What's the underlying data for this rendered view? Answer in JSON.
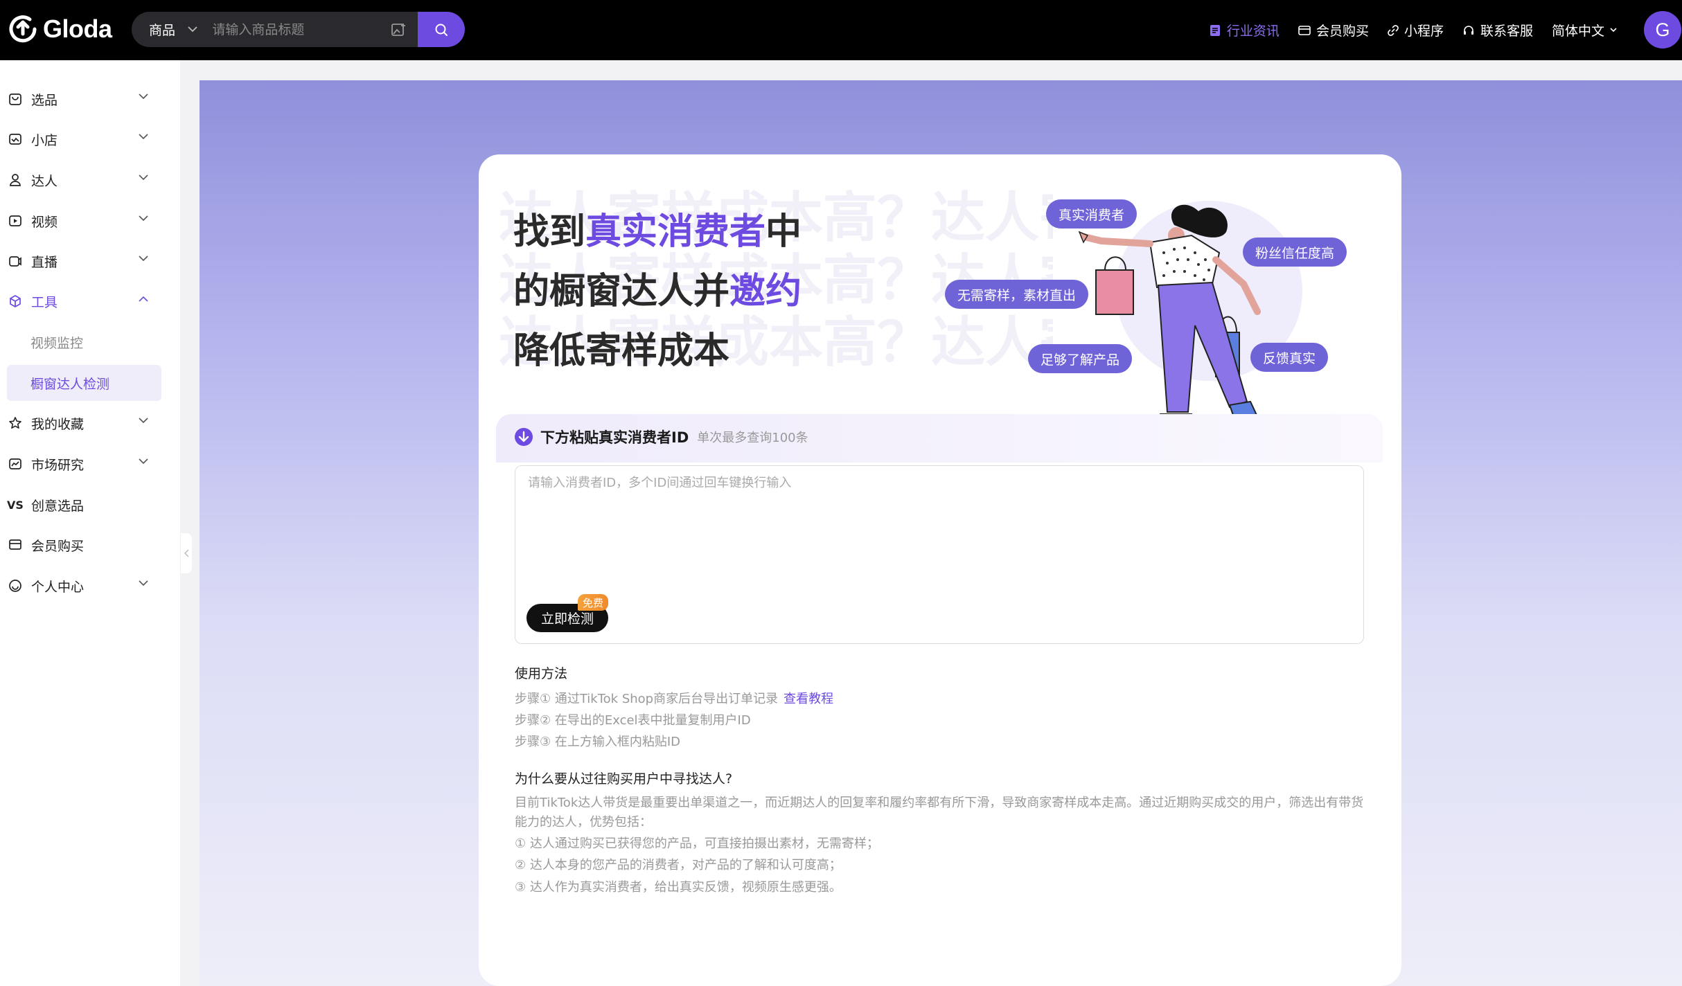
{
  "brand": {
    "name": "Gloda"
  },
  "search": {
    "category": "商品",
    "placeholder": "请输入商品标题"
  },
  "topnav": {
    "industry_news": "行业资讯",
    "membership": "会员购买",
    "mini_program": "小程序",
    "support": "联系客服",
    "language": "简体中文",
    "avatar_letter": "G"
  },
  "sidebar": {
    "items": [
      {
        "label": "选品",
        "icon": "bag-icon"
      },
      {
        "label": "小店",
        "icon": "store-icon"
      },
      {
        "label": "达人",
        "icon": "user-icon"
      },
      {
        "label": "视频",
        "icon": "video-icon"
      },
      {
        "label": "直播",
        "icon": "live-icon"
      },
      {
        "label": "工具",
        "icon": "cube-icon"
      },
      {
        "label": "我的收藏",
        "icon": "star-icon"
      },
      {
        "label": "市场研究",
        "icon": "chart-icon"
      },
      {
        "label": "创意选品",
        "icon": "vs-icon"
      },
      {
        "label": "会员购买",
        "icon": "card-icon"
      },
      {
        "label": "个人中心",
        "icon": "smile-icon"
      }
    ],
    "tools_sub": [
      "视频监控",
      "橱窗达人检测"
    ]
  },
  "hero": {
    "bg_text": "达人寄样成本高？达人寄样成本高？达人",
    "line1_a": "找到",
    "line1_hl": "真实消费者",
    "line1_b": "中",
    "line2_a": "的橱窗达人并",
    "line2_hl": "邀约",
    "line3": "降低寄样成本",
    "bubbles": [
      "真实消费者",
      "粉丝信任度高",
      "无需寄样，素材直出",
      "足够了解产品",
      "反馈真实"
    ]
  },
  "section": {
    "title": "下方粘贴真实消费者ID",
    "subtitle": "单次最多查询100条",
    "textarea_placeholder": "请输入消费者ID，多个ID间通过回车键换行输入",
    "detect_button": "立即检测",
    "free_badge": "免费"
  },
  "howto": {
    "title": "使用方法",
    "step1": "步骤① 通过TikTok Shop商家后台导出订单记录",
    "step1_link": "查看教程",
    "step2": "步骤② 在导出的Excel表中批量复制用户ID",
    "step3": "步骤③ 在上方输入框内粘贴ID"
  },
  "why": {
    "title": "为什么要从过往购买用户中寻找达人?",
    "intro": "目前TikTok达人带货是最重要出单渠道之一，而近期达人的回复率和履约率都有所下滑，导致商家寄样成本走高。通过近期购买成交的用户，筛选出有带货能力的达人，优势包括：",
    "p1": "① 达人通过购买已获得您的产品，可直接拍摄出素材，无需寄样；",
    "p2": "② 达人本身的您产品的消费者，对产品的了解和认可度高；",
    "p3": "③ 达人作为真实消费者，给出真实反馈，视频原生感更强。"
  },
  "colors": {
    "accent": "#6d4ae0",
    "bubble": "#6f63d8"
  }
}
